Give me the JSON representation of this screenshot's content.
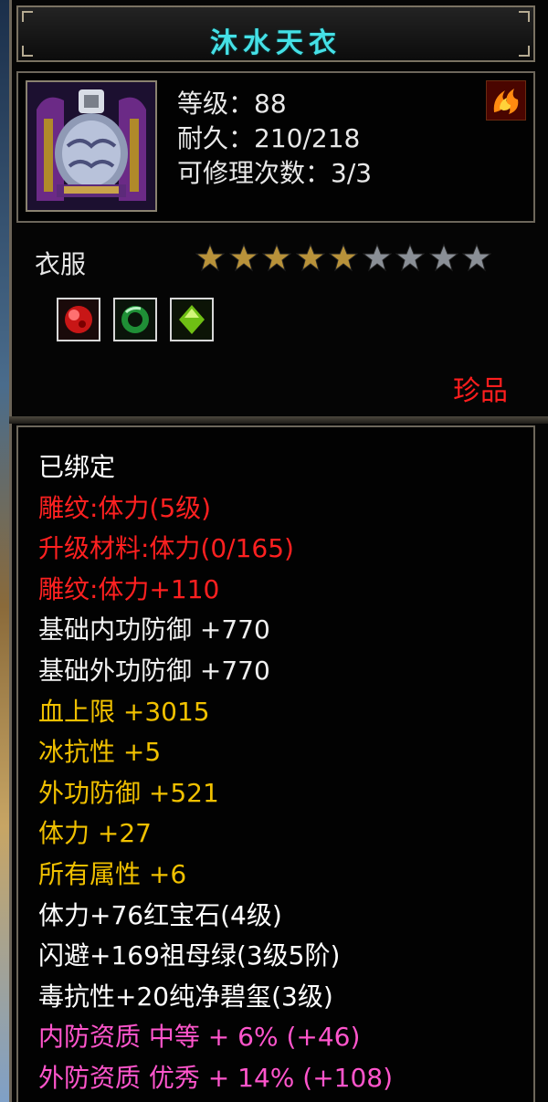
{
  "item": {
    "name": "沐水天衣",
    "level_line": "等级：88",
    "durability_line": "耐久：210/218",
    "repair_line": "可修理次数：3/3",
    "category": "衣服",
    "stars_total": 9,
    "stars_filled": 5,
    "rarity": "珍品",
    "gems": [
      {
        "name": "ruby-gem",
        "color": "#e11b1b"
      },
      {
        "name": "emerald-gem",
        "color": "#1f9b3a"
      },
      {
        "name": "jade-gem",
        "color": "#7ecb1a"
      }
    ]
  },
  "attributes": [
    {
      "text": "已绑定",
      "color": "#ffffff"
    },
    {
      "text": "雕纹:体力(5级)",
      "color": "#ff2020"
    },
    {
      "text": "升级材料:体力(0/165)",
      "color": "#ff2020"
    },
    {
      "text": "雕纹:体力+110",
      "color": "#ff2020"
    },
    {
      "text": "基础内功防御 +770",
      "color": "#f0f0f0"
    },
    {
      "text": "基础外功防御 +770",
      "color": "#f0f0f0"
    },
    {
      "text": "血上限 +3015",
      "color": "#f0c000"
    },
    {
      "text": "冰抗性 +5",
      "color": "#f0c000"
    },
    {
      "text": "外功防御 +521",
      "color": "#f0c000"
    },
    {
      "text": "体力 +27",
      "color": "#f0c000"
    },
    {
      "text": "所有属性 +6",
      "color": "#f0c000"
    },
    {
      "text": "体力+76红宝石(4级)",
      "color": "#ffffff"
    },
    {
      "text": "闪避+169祖母绿(3级5阶)",
      "color": "#ffffff"
    },
    {
      "text": "毒抗性+20纯净碧玺(3级)",
      "color": "#ffffff"
    },
    {
      "text": "内防资质 中等 + 6% (+46)",
      "color": "#ff55cc"
    },
    {
      "text": "外防资质 优秀 + 14% (+108)",
      "color": "#ff55cc"
    }
  ],
  "colors": {
    "title": "#45e0e6",
    "star_filled": "#b8923a",
    "star_empty": "#8a8f96"
  }
}
